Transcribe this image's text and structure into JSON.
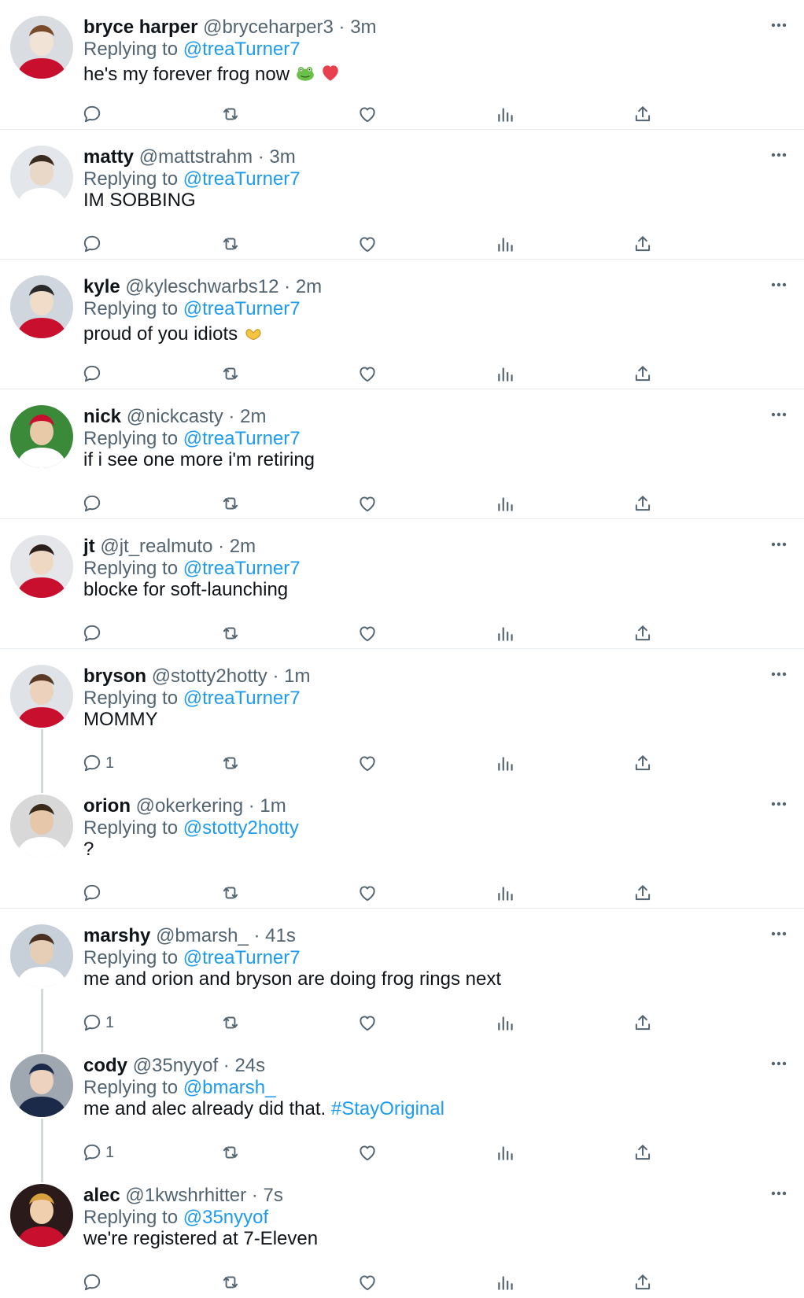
{
  "colors": {
    "link": "#1d9bf0",
    "muted": "#536471",
    "text": "#0f1419",
    "divider": "#e6ecf0",
    "thread_line": "#cfd9de",
    "heart_emoji": "#e8404c",
    "frog_emoji": "#6cc04a"
  },
  "icons": {
    "more": "more-horizontal-icon",
    "reply": "reply-bubble-icon",
    "retweet": "retweet-icon",
    "like": "heart-icon",
    "views": "analytics-bars-icon",
    "share": "share-upload-icon"
  },
  "tweets": [
    {
      "name": "bryce harper",
      "handle": "@bryceharper3",
      "time": "3m",
      "replying_label": "Replying to",
      "replying_to": "@treaTurner7",
      "text": "he's my forever frog now",
      "emojis": [
        "frog",
        "red-heart"
      ],
      "reply_count": ""
    },
    {
      "name": "matty",
      "handle": "@mattstrahm",
      "time": "3m",
      "replying_label": "Replying to",
      "replying_to": "@treaTurner7",
      "text": "IM SOBBING",
      "reply_count": ""
    },
    {
      "name": "kyle",
      "handle": "@kyleschwarbs12",
      "time": "2m",
      "replying_label": "Replying to",
      "replying_to": "@treaTurner7",
      "text": "proud of you idiots",
      "emojis": [
        "heart-hands"
      ],
      "reply_count": ""
    },
    {
      "name": "nick",
      "handle": "@nickcasty",
      "time": "2m",
      "replying_label": "Replying to",
      "replying_to": "@treaTurner7",
      "text": "if i see one more i'm retiring",
      "reply_count": ""
    },
    {
      "name": "jt",
      "handle": "@jt_realmuto",
      "time": "2m",
      "replying_label": "Replying to",
      "replying_to": "@treaTurner7",
      "text": "blocke for soft-launching",
      "reply_count": ""
    },
    {
      "name": "bryson",
      "handle": "@stotty2hotty",
      "time": "1m",
      "replying_label": "Replying to",
      "replying_to": "@treaTurner7",
      "text": "MOMMY",
      "reply_count": "1"
    },
    {
      "name": "orion",
      "handle": "@okerkering",
      "time": "1m",
      "replying_label": "Replying to",
      "replying_to": "@stotty2hotty",
      "text": "?",
      "reply_count": ""
    },
    {
      "name": "marshy",
      "handle": "@bmarsh_",
      "time": "41s",
      "replying_label": "Replying to",
      "replying_to": "@treaTurner7",
      "text": "me and orion and bryson are doing frog rings next",
      "reply_count": "1"
    },
    {
      "name": "cody",
      "handle": "@35nyyof",
      "time": "24s",
      "replying_label": "Replying to",
      "replying_to": "@bmarsh_",
      "text": "me and alec already did that.",
      "hashtag": "#StayOriginal",
      "reply_count": "1"
    },
    {
      "name": "alec",
      "handle": "@1kwshrhitter",
      "time": "7s",
      "replying_label": "Replying to",
      "replying_to": "@35nyyof",
      "text": "we're registered at 7-Eleven",
      "reply_count": ""
    }
  ]
}
